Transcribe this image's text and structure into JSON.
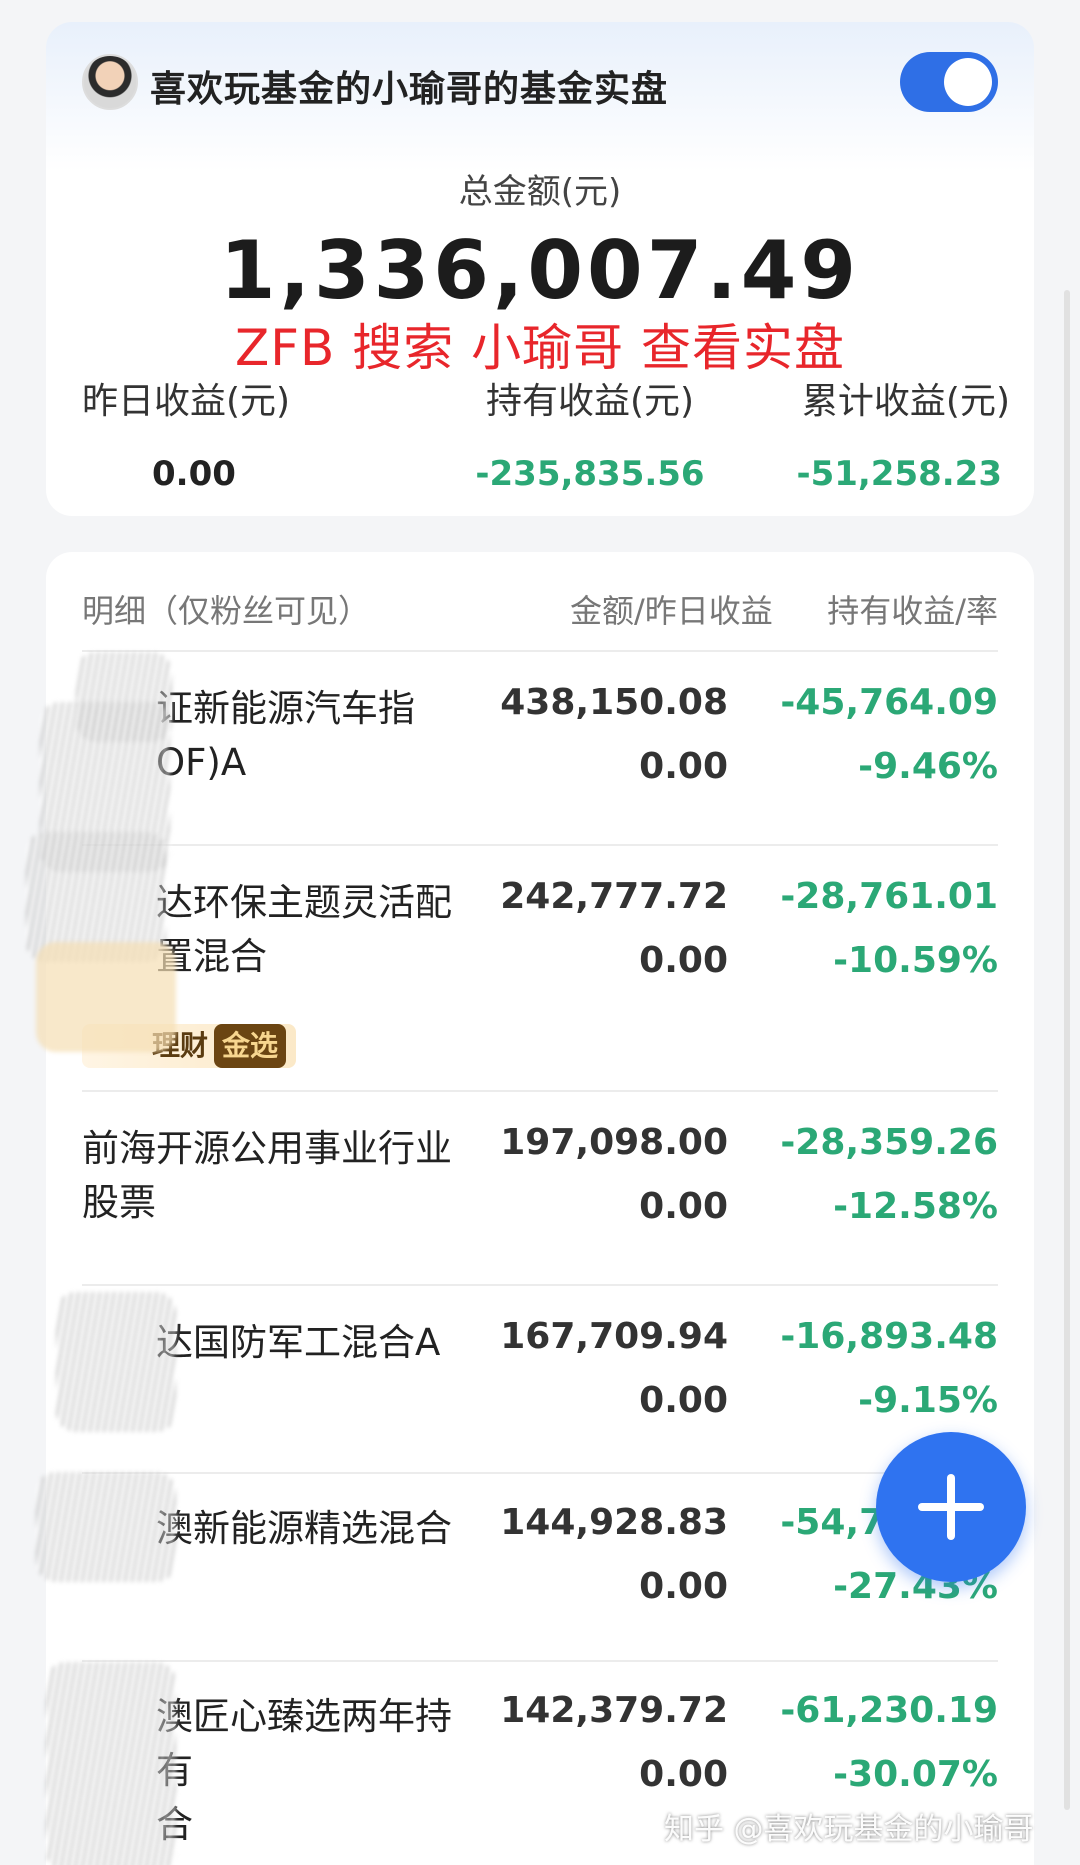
{
  "header": {
    "owner_title": "喜欢玩基金的小瑜哥的基金实盘",
    "toggle_state": "on"
  },
  "summary": {
    "total_label": "总金额(元)",
    "total_value": "1,336,007.49",
    "promo_text": "ZFB 搜索 小瑜哥 查看实盘",
    "yesterday_label": "昨日收益(元)",
    "yesterday_value": "0.00",
    "holding_label": "持有收益(元)",
    "holding_value": "-235,835.56",
    "cumulative_label": "累计收益(元)",
    "cumulative_value": "-51,258.23"
  },
  "detail": {
    "header_col1": "明细（仅粉丝可见）",
    "header_col2": "金额/昨日收益",
    "header_col3": "持有收益/率",
    "rows": [
      {
        "name": "证新能源汽车指\nOF)A",
        "amount": "438,150.08",
        "yesterday": "0.00",
        "holding": "-45,764.09",
        "rate": "-9.46%"
      },
      {
        "name": "达环保主题灵活配\n置混合",
        "amount": "242,777.72",
        "yesterday": "0.00",
        "holding": "-28,761.01",
        "rate": "-10.59%",
        "badge_text": "理财",
        "badge_gold": "金选"
      },
      {
        "name": "前海开源公用事业行业\n股票",
        "amount": "197,098.00",
        "yesterday": "0.00",
        "holding": "-28,359.26",
        "rate": "-12.58%"
      },
      {
        "name": "达国防军工混合A",
        "amount": "167,709.94",
        "yesterday": "0.00",
        "holding": "-16,893.48",
        "rate": "-9.15%"
      },
      {
        "name": "澳新能源精选混合",
        "amount": "144,928.83",
        "yesterday": "0.00",
        "holding": "-54,790.73",
        "rate": "-27.43%"
      },
      {
        "name": "澳匠心臻选两年持有\n合",
        "amount": "142,379.72",
        "yesterday": "0.00",
        "holding": "-61,230.19",
        "rate": "-30.07%"
      }
    ]
  },
  "watermark": "知乎 @喜欢玩基金的小瑜哥",
  "colors": {
    "accent_blue": "#2f73f0",
    "gain_green": "#2ba876",
    "promo_red": "#e8262b"
  },
  "icons": [
    "avatar",
    "toggle",
    "plus-icon"
  ]
}
